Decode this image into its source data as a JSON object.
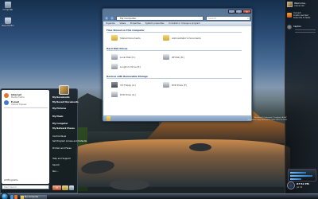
{
  "desktop_icons": [
    {
      "label": "Computer",
      "icon": "computer-icon"
    },
    {
      "label": "Recycle Bin",
      "icon": "recycle-bin-icon"
    }
  ],
  "explorer": {
    "address": "My Computer",
    "search_placeholder": "Search",
    "commands": [
      "Organize",
      "Views",
      "Properties",
      "System properties",
      "Uninstall or change a program"
    ],
    "groups": [
      {
        "title": "Files Stored on This Computer",
        "items": [
          "Shared Documents",
          "Administrator's Documents"
        ]
      },
      {
        "title": "Hard Disk Drives",
        "items": [
          "Local Disk (C:)",
          "ZP Disk (D:)",
          "Longhorn Drive (E:)"
        ]
      },
      {
        "title": "Devices with Removable Storage",
        "items": [
          "3½ Floppy (A:)",
          "DVD Drive (F:)",
          "DVD Drive (G:)"
        ]
      }
    ]
  },
  "start_menu": {
    "pinned": [
      {
        "title": "Internet",
        "subtitle": "Mozilla Firefox",
        "color": "#e8742b"
      },
      {
        "title": "E-mail",
        "subtitle": "Outlook Express",
        "color": "#3a7fc8"
      }
    ],
    "all_programs": "All Programs",
    "search_placeholder": "Start Search",
    "right_links": [
      "My Documents",
      "My Recent Documents",
      "My Pictures",
      "My Music",
      "My Computer",
      "My Network Places",
      "Control Panel",
      "Set Program Access and Defaults",
      "Printers and Faxes",
      "Help and Support",
      "Search",
      "Run..."
    ]
  },
  "taskbar": {
    "task_label": "My Computer"
  },
  "sidebar": {
    "welcome": "Welcome,",
    "user": "Alexander",
    "feed_lines": [
      "Connect",
      "Create new feed",
      "Subscribe to feeds"
    ],
    "caption": "Caption",
    "time": "07:52 PM",
    "date": "Jul 19"
  },
  "watermark": {
    "line1": "Windows® Codename \"Longhorn Build\"",
    "line2": "Evaluation copy. Build 4015.0000.030715-1000"
  }
}
